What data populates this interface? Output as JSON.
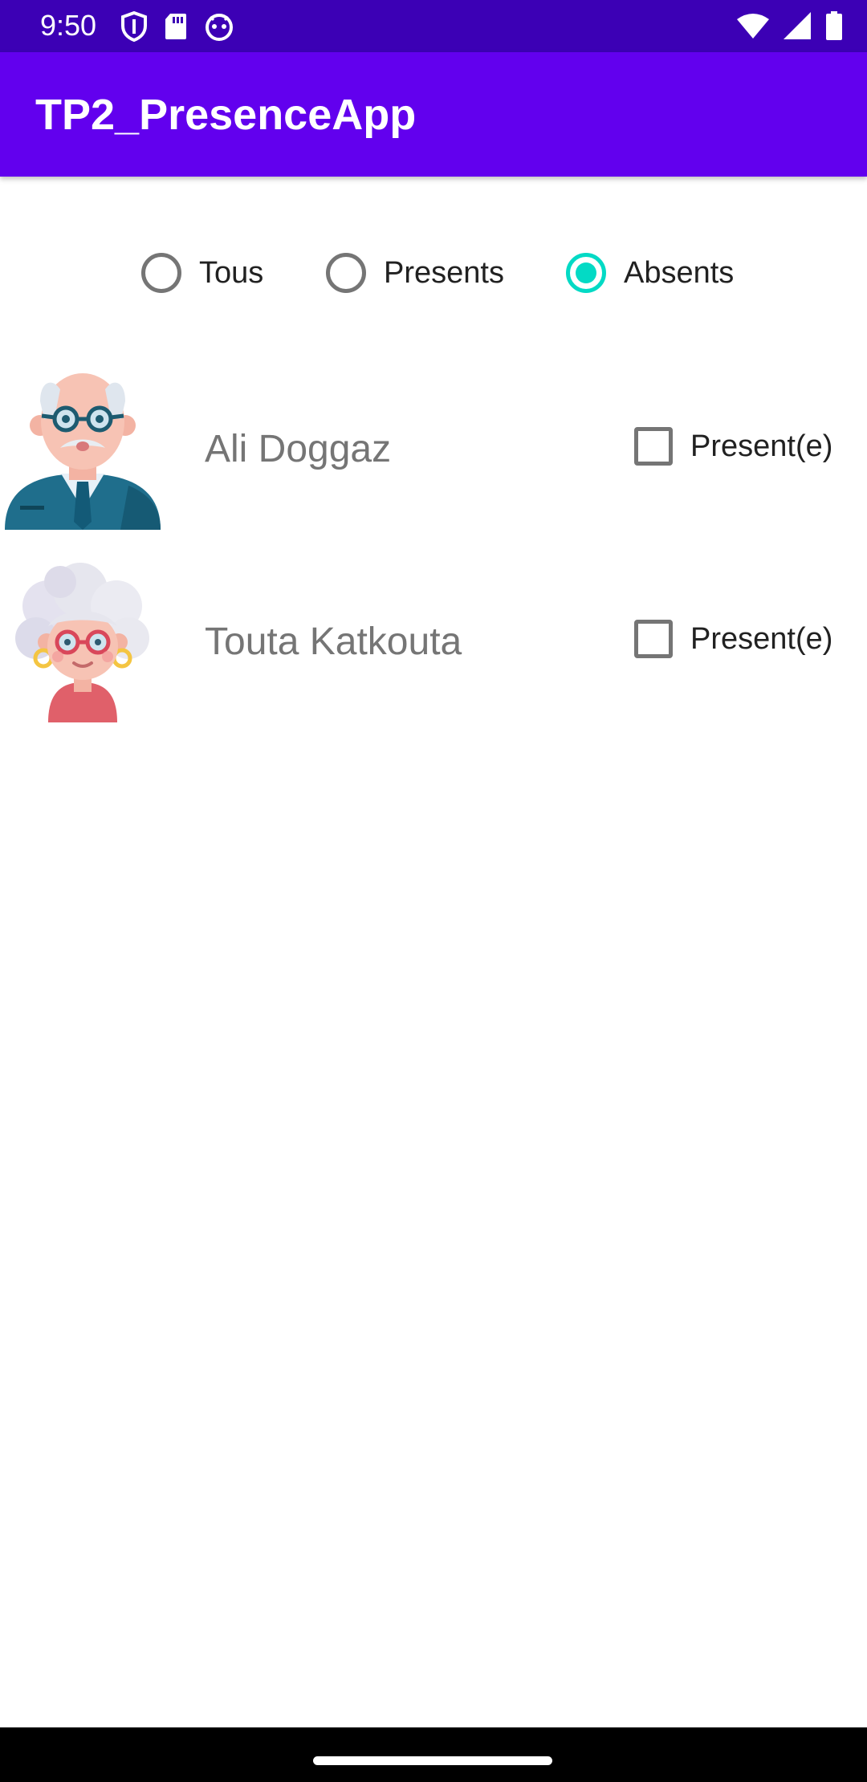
{
  "status_bar": {
    "time": "9:50",
    "left_icons": [
      "shield-icon",
      "sd-card-icon",
      "android-debug-icon"
    ],
    "right_icons": [
      "wifi-icon",
      "signal-icon",
      "battery-icon"
    ],
    "bg_color": "#3c00b5"
  },
  "app_bar": {
    "title": "TP2_PresenceApp",
    "bg_color": "#6200ee"
  },
  "filter": {
    "options": [
      {
        "label": "Tous",
        "checked": false
      },
      {
        "label": "Presents",
        "checked": false
      },
      {
        "label": "Absents",
        "checked": true
      }
    ],
    "accent_color": "#03dac5"
  },
  "people": [
    {
      "name": "Ali Doggaz",
      "avatar": "old-man-avatar-icon",
      "checkbox_label": "Present(e)",
      "checked": false
    },
    {
      "name": "Touta Katkouta",
      "avatar": "old-woman-avatar-icon",
      "checkbox_label": "Present(e)",
      "checked": false
    }
  ]
}
